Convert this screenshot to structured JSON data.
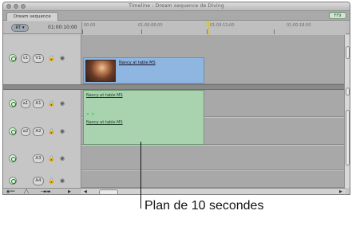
{
  "window": {
    "title": "Timeline : Dream sequence de Diving",
    "tab": "Dream sequence",
    "top_right_button": "FF9"
  },
  "timeline": {
    "timecode": "01:00:10:00",
    "ruler_labels": [
      "00:00",
      "01:00:06:00",
      "01:00:12:00",
      "01:00:18:00"
    ]
  },
  "tracks": [
    {
      "name": "v1",
      "slot": "V1"
    },
    {
      "name": "a1",
      "slot": "A1"
    },
    {
      "name": "a2",
      "slot": "A2"
    },
    {
      "name": "",
      "slot": "A3"
    },
    {
      "name": "",
      "slot": "A4"
    }
  ],
  "clips": {
    "video": "Nancy at table MS",
    "audio1": "Nancy at table MS",
    "audio2": "Nancy at table MS"
  },
  "caption": "Plan de 10 secondes",
  "icons": {
    "lock": "lock-icon",
    "eye": "eye-icon",
    "target": "track-toggle-icon"
  },
  "colors": {
    "video_clip": "#8fb6e1",
    "audio_clip": "#a8d3ae",
    "playhead": "#d3c54d"
  }
}
